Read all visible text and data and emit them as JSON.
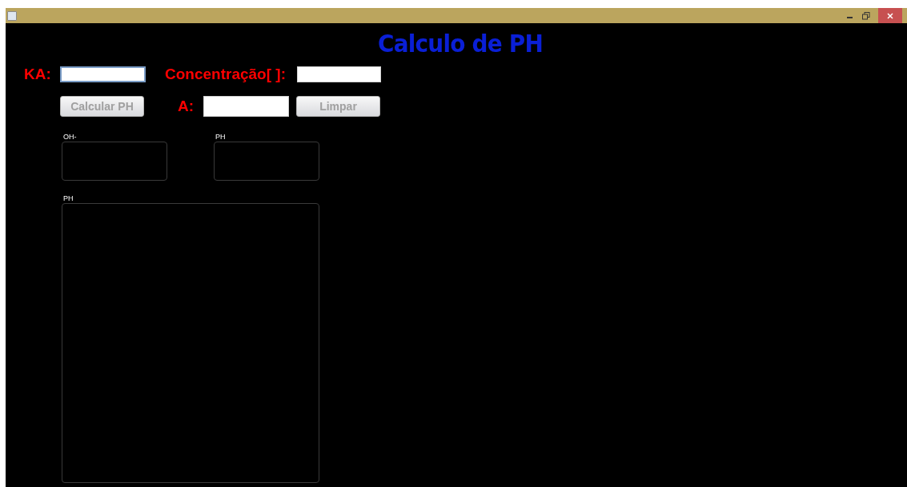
{
  "window": {
    "title": "Calculo de PH"
  },
  "fields": [
    {
      "label": "KA:",
      "focused": true
    },
    {
      "label": "Concentração[ ]:",
      "focused": false
    },
    {
      "label": "A:",
      "focused": false
    }
  ],
  "buttons": [
    {
      "label": "Calcular PH",
      "disabled": true
    },
    {
      "label": "Limpar",
      "disabled": true
    }
  ],
  "outputs": [
    {
      "label": "OH-"
    },
    {
      "label": "PH"
    },
    {
      "label": "PH"
    }
  ]
}
